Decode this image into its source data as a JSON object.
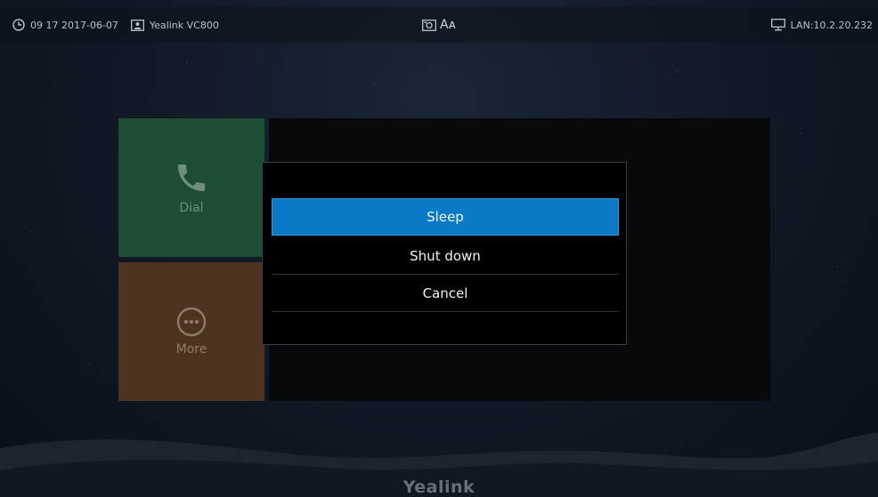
{
  "status_bar": {
    "time_date": "09 17 2017-06-07",
    "device_name": "Yealink VC800",
    "font_size_indicator": "Aᴀ",
    "network": "LAN:10.2.20.232",
    "icons": [
      "clock-icon",
      "account-icon",
      "camera-icon",
      "font-icon",
      "network-monitor-icon"
    ]
  },
  "tiles": {
    "dial_label": "Dial",
    "more_label": "More",
    "dial_color": "#1d4e33",
    "more_color": "#4e3420"
  },
  "dialog": {
    "options": [
      "Sleep",
      "Shut down",
      "Cancel"
    ],
    "selected_index": 0,
    "accent": "#0a7ac8"
  },
  "brand": "Yealink"
}
